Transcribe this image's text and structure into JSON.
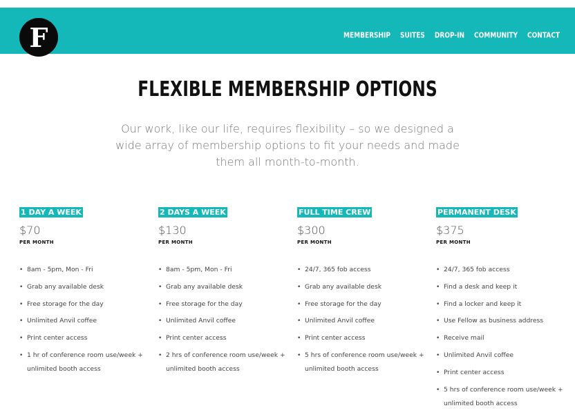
{
  "logo": {
    "letter": "F"
  },
  "nav": [
    "MEMBERSHIP",
    "SUITES",
    "DROP-IN",
    "COMMUNITY",
    "CONTACT"
  ],
  "page": {
    "title": "FLEXIBLE MEMBERSHIP OPTIONS",
    "subtitle": "Our work, like our life, requires flexibility – so we designed a wide array of membership options to fit your needs and made them all month-to-month."
  },
  "plans": [
    {
      "name": "1 DAY A WEEK",
      "price": "$70",
      "per": "PER MONTH",
      "features": [
        "8am - 5pm, Mon - Fri",
        "Grab any available desk",
        "Free storage for the day",
        "Unlimited Anvil coffee",
        "Print center access",
        "1 hr of conference room use/week + unlimited booth access"
      ]
    },
    {
      "name": "2 DAYS A WEEK",
      "price": "$130",
      "per": "PER MONTH",
      "features": [
        "8am - 5pm, Mon - Fri",
        "Grab any available desk",
        "Free storage for the day",
        "Unlimited Anvil coffee",
        "Print center access",
        " 2 hrs of conference room use/week + unlimited booth access"
      ]
    },
    {
      "name": "FULL TIME CREW",
      "price": "$300",
      "per": "PER MONTH",
      "features": [
        "24/7, 365 fob access",
        "Grab any available desk",
        "Free storage for the day",
        "Unlimited Anvil coffee",
        "Print center access",
        "5 hrs of conference room use/week + unlimited booth access"
      ]
    },
    {
      "name": "PERMANENT DESK",
      "price": "$375",
      "per": "PER MONTH",
      "features": [
        "24/7, 365 fob access",
        "Find a desk and keep it",
        "Find a locker and keep it",
        "Use Fellow as business address",
        "Receive mail",
        "Unlimited Anvil coffee",
        "Print center access",
        "5 hrs of conference room use/week + unlimited booth access"
      ]
    }
  ]
}
